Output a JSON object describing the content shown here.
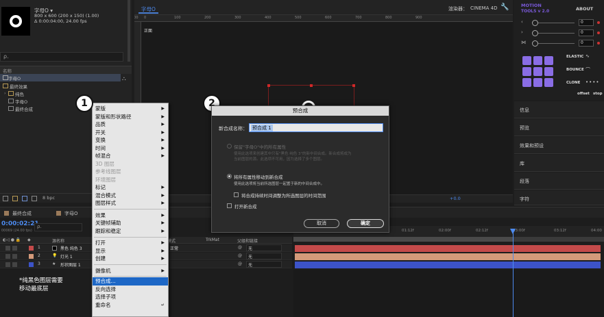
{
  "project": {
    "comp_name": "字母O ▾",
    "comp_info": "800 x 600 (200 x 150) (1.00)",
    "comp_duration": "Δ 0:00:04:00, 24.00 fps",
    "search_placeholder": "ρ.",
    "col_name": "名称",
    "items": [
      "字母O",
      "最终效果",
      "纯色",
      "字母O",
      "最终合成"
    ],
    "bpc": "8 bpc"
  },
  "viewer": {
    "tab": "字母O",
    "renderer_label": "渲染器：",
    "renderer_value": "CINEMA 4D",
    "view_label": "正面",
    "ruler_ticks": [
      "100",
      "0",
      "100",
      "200",
      "300",
      "400",
      "500",
      "600",
      "700",
      "800",
      "900"
    ],
    "zoom_value": "+0.0"
  },
  "motion": {
    "logo": "MOTION",
    "tools": "TOOLS v 2.0",
    "about": "ABOUT",
    "rows": [
      {
        "symbol": "‹",
        "value": "0"
      },
      {
        "symbol": "›",
        "value": "0"
      },
      {
        "symbol": "⋈",
        "value": "0"
      }
    ],
    "elastic": "ELASTIC",
    "bounce": "BOUNCE",
    "clone": "CLONE",
    "offset": "offset",
    "stop": "stop"
  },
  "right_panel": [
    "信息",
    "预览",
    "效果和预设",
    "库",
    "段落",
    "字符"
  ],
  "timeline": {
    "tabs": [
      "最终合成",
      "字母O"
    ],
    "time": "0:00:02:21",
    "fps": "00069 (24.00 fps)",
    "search_placeholder": "ρ.",
    "col_source": "源名称",
    "col_mode": "模式",
    "col_trkmat": "TrkMat",
    "col_parent": "父级和链接",
    "ticks": [
      "01:12f",
      "02:00f",
      "02:12f",
      "03:00f",
      "03:12f",
      "04:00"
    ],
    "layers": [
      {
        "num": "1",
        "name": "黑色 纯色 3",
        "parent": "无",
        "color": "#c44a4a"
      },
      {
        "num": "2",
        "name": "灯光 1",
        "parent": "无",
        "color": "#d49a7a"
      },
      {
        "num": "3",
        "name": "形状图层 1",
        "parent": "无",
        "color": "#3c53c8"
      }
    ],
    "mode_value": "正常",
    "note_line1": "*纯黑色图层需要",
    "note_line2": "移动最底层"
  },
  "context_menu": {
    "items": [
      {
        "label": "蒙版",
        "arrow": true,
        "disabled": false
      },
      {
        "label": "蒙版和形状路径",
        "arrow": true,
        "disabled": false
      },
      {
        "label": "品质",
        "arrow": true,
        "disabled": false
      },
      {
        "label": "开关",
        "arrow": true,
        "disabled": false
      },
      {
        "label": "变换",
        "arrow": true,
        "disabled": false
      },
      {
        "label": "时间",
        "arrow": true,
        "disabled": false
      },
      {
        "label": "帧混合",
        "arrow": true,
        "disabled": false
      },
      {
        "label": "3D 图层",
        "arrow": false,
        "disabled": true
      },
      {
        "label": "参考线图层",
        "arrow": false,
        "disabled": true
      },
      {
        "label": "环境图层",
        "arrow": false,
        "disabled": true
      },
      {
        "label": "标记",
        "arrow": true,
        "disabled": false
      },
      {
        "label": "混合模式",
        "arrow": true,
        "disabled": false
      },
      {
        "label": "图层样式",
        "arrow": true,
        "disabled": false
      },
      {
        "label": "效果",
        "arrow": true,
        "disabled": false
      },
      {
        "label": "关键帧辅助",
        "arrow": true,
        "disabled": false
      },
      {
        "label": "跟踪和稳定",
        "arrow": true,
        "disabled": false
      },
      {
        "label": "打开",
        "arrow": true,
        "disabled": false
      },
      {
        "label": "显示",
        "arrow": true,
        "disabled": false
      },
      {
        "label": "创建",
        "arrow": true,
        "disabled": false
      },
      {
        "label": "摄像机",
        "arrow": true,
        "disabled": false
      },
      {
        "label": "预合成...",
        "arrow": false,
        "disabled": false,
        "highlight": true
      },
      {
        "label": "反向选择",
        "arrow": false,
        "disabled": false
      },
      {
        "label": "选择子项",
        "arrow": false,
        "disabled": false
      },
      {
        "label": "重命名",
        "arrow": false,
        "disabled": false,
        "extra": "↵"
      }
    ]
  },
  "badges": {
    "one": "1",
    "two": "2"
  },
  "dialog": {
    "title": "预合成",
    "name_label": "新合成名称：",
    "name_value": "预合成 1",
    "opt1_label": "保留\"字母O\"中的所有属性",
    "opt1_desc1": "使用此选项来创建其中只有\"黑色 纯色 3\"的新中间合成。新合成将成为",
    "opt1_desc2": "当前图层的源。此选项不可用，因为选择了多个图层。",
    "opt2_label": "将所有属性移动到新合成",
    "opt2_desc": "使用此选项将当前所选图层一起置于新的中间合成中。",
    "check1": "将合成持续时间调整为所选图层的时间范围",
    "check2": "打开新合成",
    "cancel": "取消",
    "ok": "确定"
  }
}
